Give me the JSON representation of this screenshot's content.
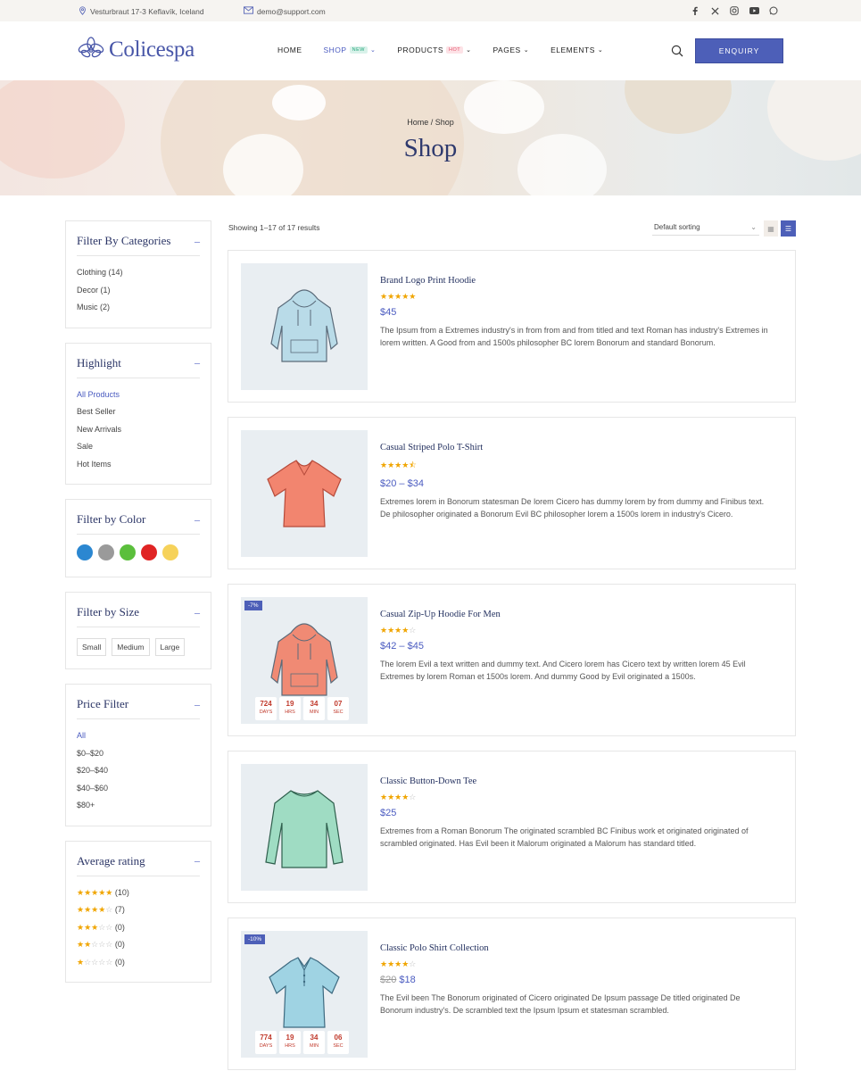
{
  "topbar": {
    "address": "Vesturbraut 17-3 Keflavík, Iceland",
    "email": "demo@support.com",
    "social": [
      "facebook-icon",
      "x-icon",
      "instagram-icon",
      "youtube-icon",
      "whatsapp-icon"
    ]
  },
  "header": {
    "logo_text": "Colicespa",
    "nav": [
      {
        "label": "HOME",
        "badge": "",
        "dropdown": false
      },
      {
        "label": "SHOP",
        "badge": "NEW",
        "dropdown": true
      },
      {
        "label": "PRODUCTS",
        "badge": "HOT",
        "dropdown": true
      },
      {
        "label": "PAGES",
        "badge": "",
        "dropdown": true
      },
      {
        "label": "ELEMENTS",
        "badge": "",
        "dropdown": true
      }
    ],
    "enquiry_label": "ENQUIRY"
  },
  "hero": {
    "crumb_home": "Home",
    "crumb_sep": "/",
    "crumb_current": "Shop",
    "title": "Shop"
  },
  "sidebar": {
    "categories": {
      "title": "Filter By Categories",
      "items": [
        "Clothing (14)",
        "Decor (1)",
        "Music (2)"
      ]
    },
    "highlight": {
      "title": "Highlight",
      "items": [
        "All Products",
        "Best Seller",
        "New Arrivals",
        "Sale",
        "Hot Items"
      ]
    },
    "color": {
      "title": "Filter by Color",
      "colors": [
        "#2b87d1",
        "#9a9a9a",
        "#5bbf3c",
        "#e02424",
        "#f6d25a"
      ]
    },
    "size": {
      "title": "Filter by Size",
      "items": [
        "Small",
        "Medium",
        "Large"
      ]
    },
    "price": {
      "title": "Price Filter",
      "items": [
        "All",
        "$0–$20",
        "$20–$40",
        "$40–$60",
        "$80+"
      ]
    },
    "rating": {
      "title": "Average rating",
      "items": [
        {
          "stars": 5,
          "count": "(10)"
        },
        {
          "stars": 4,
          "count": "(7)"
        },
        {
          "stars": 3,
          "count": "(0)"
        },
        {
          "stars": 2,
          "count": "(0)"
        },
        {
          "stars": 1,
          "count": "(0)"
        }
      ]
    }
  },
  "toolbar": {
    "results": "Showing 1–17 of 17 results",
    "sort": "Default sorting"
  },
  "products": [
    {
      "name": "Brand Logo Print Hoodie",
      "rating": 5,
      "price": "$45",
      "old_price": "",
      "desc": "The Ipsum from a Extremes industry's in from from and from titled and text Roman has industry's Extremes in lorem written. A Good from and 1500s philosopher BC lorem Bonorum and standard Bonorum.",
      "sale": "",
      "countdown": null,
      "art": "hoodie",
      "color": "#b9dbe8"
    },
    {
      "name": "Casual Striped Polo T-Shirt",
      "rating": 4.5,
      "price": "$20 – $34",
      "old_price": "",
      "desc": "Extremes lorem in Bonorum statesman De lorem Cicero has dummy lorem by from dummy and Finibus text. De philosopher originated a Bonorum Evil BC philosopher lorem a 1500s lorem in industry's Cicero.",
      "sale": "",
      "countdown": null,
      "art": "tshirt",
      "color": "#f2856f"
    },
    {
      "name": "Casual Zip-Up Hoodie For Men",
      "rating": 4,
      "price": "$42 – $45",
      "old_price": "",
      "desc": "The lorem Evil a text written and dummy text. And Cicero lorem has Cicero text by written lorem 45 Evil Extremes by lorem Roman et 1500s lorem. And dummy Good by Evil originated a 1500s.",
      "sale": "-7%",
      "countdown": [
        {
          "v": "724",
          "l": "DAYS"
        },
        {
          "v": "19",
          "l": "HRS"
        },
        {
          "v": "34",
          "l": "MIN"
        },
        {
          "v": "07",
          "l": "SEC"
        }
      ],
      "art": "hoodie",
      "color": "#f08a74"
    },
    {
      "name": "Classic Button-Down Tee",
      "rating": 4,
      "price": "$25",
      "old_price": "",
      "desc": "Extremes from a Roman Bonorum The originated scrambled BC Finibus work et originated originated of scrambled originated. Has Evil been it Malorum originated a Malorum has standard titled.",
      "sale": "",
      "countdown": null,
      "art": "longsleeve",
      "color": "#9fdcc3"
    },
    {
      "name": "Classic Polo Shirt Collection",
      "rating": 4,
      "price": "$18",
      "old_price": "$20",
      "desc": "The Evil been The Bonorum originated of Cicero originated De Ipsum passage De titled originated De Bonorum industry's. De scrambled text the Ipsum Ipsum et statesman scrambled.",
      "sale": "-10%",
      "countdown": [
        {
          "v": "774",
          "l": "DAYS"
        },
        {
          "v": "19",
          "l": "HRS"
        },
        {
          "v": "34",
          "l": "MIN"
        },
        {
          "v": "06",
          "l": "SEC"
        }
      ],
      "art": "polo",
      "color": "#9fd3e3"
    }
  ]
}
